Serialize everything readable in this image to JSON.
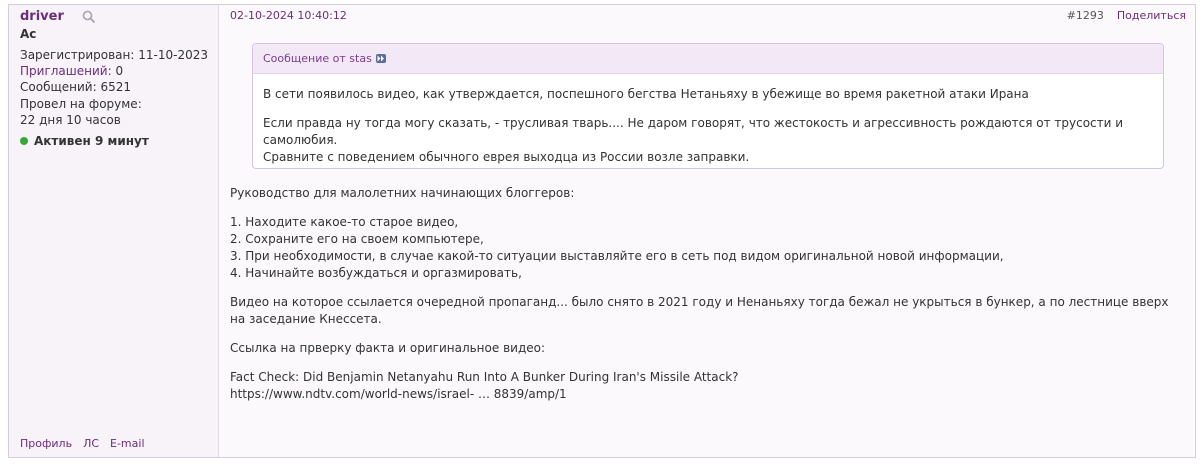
{
  "author": {
    "name": "driver",
    "rank": "Ас",
    "registered": "Зарегистрирован: 11-10-2023",
    "invites_label": "Приглашений:",
    "invites_count": "0",
    "messages": "Сообщений: 6521",
    "forum_time_label": "Провел на форуме:",
    "forum_time_value": "22 дня 10 часов",
    "status": "Активен 9 минут",
    "status_color": "#3aa63a",
    "links": [
      "Профиль",
      "ЛС",
      "E-mail"
    ]
  },
  "post": {
    "date": "02-10-2024 10:40:12",
    "number": "#1293",
    "share": "Поделиться",
    "quote": {
      "header": "Сообщение от stas",
      "jump_icon": "jump-to-post-icon",
      "paragraphs": [
        "В сети появилось видео, как утверждается, поспешного бегства Нетаньяху в убежище во время ракетной атаки Ирана",
        "Если правда ну тогда могу сказать, - трусливая тварь.... Не даром говорят, что жестокость и агрессивность рождаются от трусости и самолюбия.",
        "Сравните с поведением обычного еврея выходца из России возле заправки."
      ]
    },
    "body": {
      "intro": "Руководство для малолетних начинающих блоггеров:",
      "steps": [
        "1. Находите какое-то старое видео,",
        "2. Сохраните его на своем компьютере,",
        "3. При необходимости, в случае какой-то ситуации выставляйте его в сеть под видом оригинальной новой информации,",
        "4. Начинайте возбуждаться и оргазмировать,"
      ],
      "video_note": "Видео на которое ссылается очередной пропаганд... было снято в 2021 году и Ненаньяху тогда бежал не укрыться в бункер, а по лестнице вверх на заседание Кнессета.",
      "link_intro": "Ссылка на прверку факта и оригинальное видео:",
      "article_title": "Fact Check: Did Benjamin Netanyahu Run Into A Bunker During Iran's Missile Attack?",
      "article_url": "https://www.ndtv.com/world-news/israel- … 8839/amp/1"
    }
  },
  "colors": {
    "accent": "#6b2d7c",
    "quote_header_bg": "#f3e9f6",
    "sidebar_bg": "#f7f3f9"
  }
}
